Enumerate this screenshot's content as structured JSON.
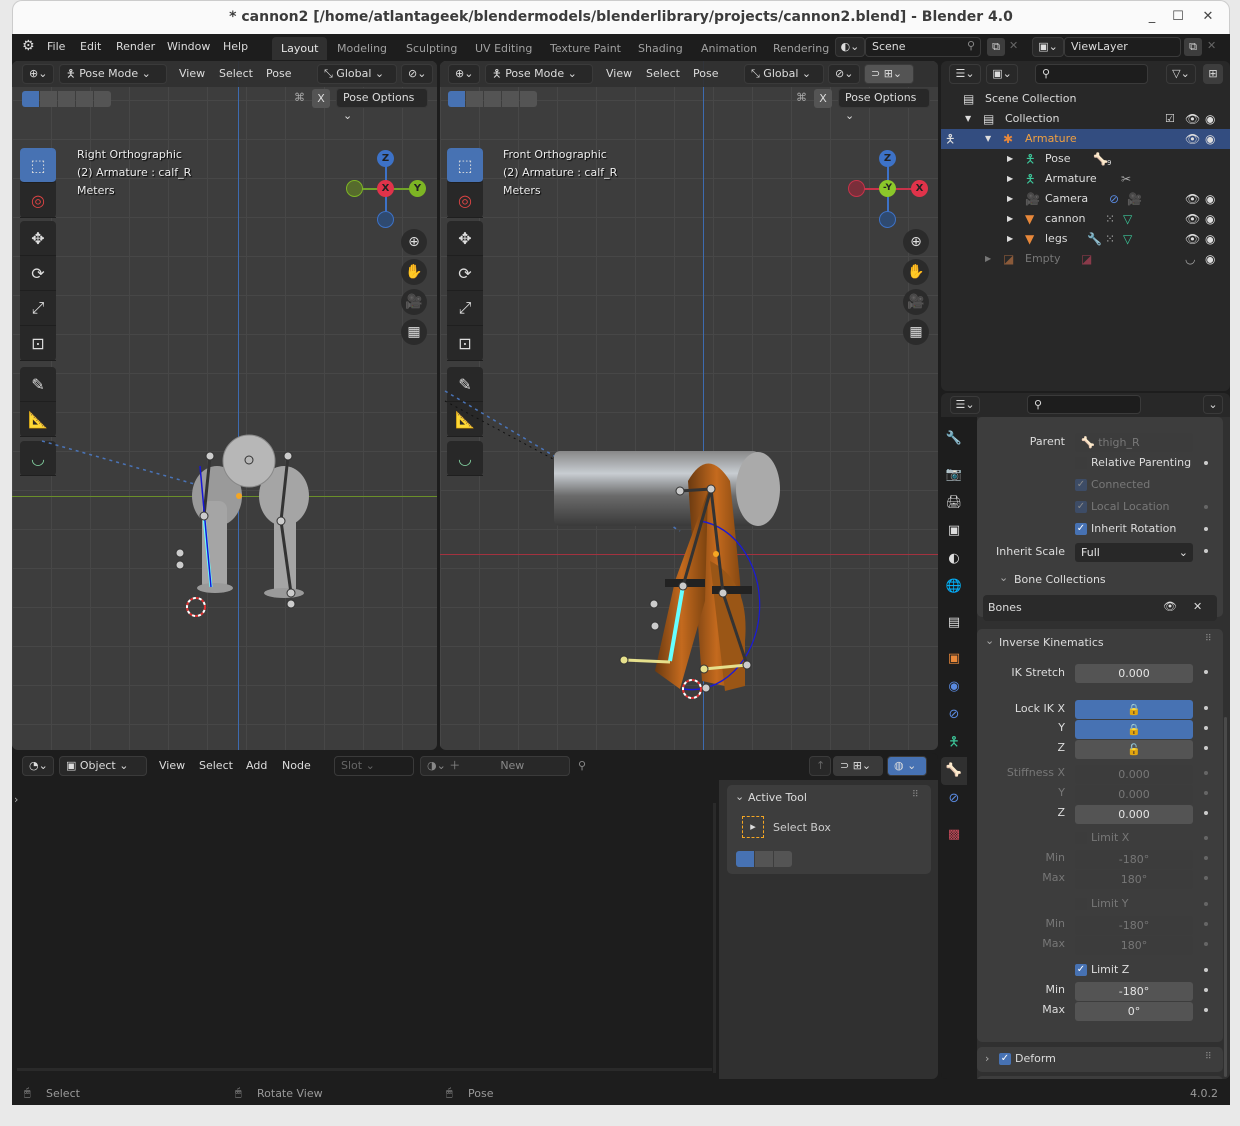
{
  "window": {
    "title": "* cannon2 [/home/atlantageek/blendermodels/blenderlibrary/projects/cannon2.blend] - Blender 4.0",
    "minimize": "_",
    "maximize": "☐",
    "close": "✕"
  },
  "topbar": {
    "menus": [
      "File",
      "Edit",
      "Render",
      "Window",
      "Help"
    ],
    "workspaces": [
      "Layout",
      "Modeling",
      "Sculpting",
      "UV Editing",
      "Texture Paint",
      "Shading",
      "Animation",
      "Rendering"
    ],
    "active_workspace": "Layout",
    "scene": "Scene",
    "view_layer": "ViewLayer"
  },
  "viewport_left": {
    "mode": "Pose Mode",
    "menus": [
      "View",
      "Select",
      "Pose"
    ],
    "orientation": "Global",
    "mirror_x": "X",
    "pose_options": "Pose Options",
    "view_name": "Right Orthographic",
    "object_info": "(2) Armature : calf_R",
    "units": "Meters",
    "gizmo": {
      "top": "Z",
      "center": "X",
      "right": "Y"
    }
  },
  "viewport_right": {
    "mode": "Pose Mode",
    "menus": [
      "View",
      "Select",
      "Pose"
    ],
    "orientation": "Global",
    "mirror_x": "X",
    "pose_options": "Pose Options",
    "view_name": "Front Orthographic",
    "object_info": "(2) Armature : calf_R",
    "units": "Meters",
    "gizmo": {
      "top": "Z",
      "center": "-Y",
      "right": "X"
    }
  },
  "shader_editor": {
    "mode": "Object",
    "menus": [
      "View",
      "Select",
      "Add",
      "Node"
    ],
    "slot": "Slot",
    "new_label": "New",
    "active_tool": {
      "header": "Active Tool",
      "name": "Select Box"
    }
  },
  "outliner": {
    "items": [
      {
        "label": "Scene Collection",
        "depth": 0
      },
      {
        "label": "Collection",
        "depth": 1
      },
      {
        "label": "Armature",
        "depth": 2,
        "selected": true
      },
      {
        "label": "Pose",
        "depth": 3
      },
      {
        "label": "Armature",
        "depth": 3
      },
      {
        "label": "Camera",
        "depth": 3
      },
      {
        "label": "cannon",
        "depth": 3
      },
      {
        "label": "legs",
        "depth": 3
      },
      {
        "label": "Empty",
        "depth": 2,
        "dimmed": true
      }
    ],
    "pose_count": "9"
  },
  "properties": {
    "parent_label": "Parent",
    "parent_value": "thigh_R",
    "relative_parenting": {
      "label": "Relative Parenting",
      "checked": false
    },
    "connected": {
      "label": "Connected",
      "checked": true
    },
    "local_location": {
      "label": "Local Location",
      "checked": true
    },
    "inherit_rotation": {
      "label": "Inherit Rotation",
      "checked": true
    },
    "inherit_scale_label": "Inherit Scale",
    "inherit_scale_value": "Full",
    "bone_collections_header": "Bone Collections",
    "bone_collection_item": "Bones",
    "ik": {
      "header": "Inverse Kinematics",
      "ik_stretch_label": "IK Stretch",
      "ik_stretch": "0.000",
      "lock_ik_x_label": "Lock IK X",
      "lock_y_label": "Y",
      "lock_z_label": "Z",
      "lock": {
        "x": true,
        "y": true,
        "z": false
      },
      "stiffness_x_label": "Stiffness X",
      "stiffness_y_label": "Y",
      "stiffness_z_label": "Z",
      "stiffness": {
        "x": "0.000",
        "y": "0.000",
        "z": "0.000"
      },
      "limit_x": {
        "label": "Limit X",
        "checked": false,
        "min": "-180°",
        "max": "180°"
      },
      "limit_y": {
        "label": "Limit Y",
        "checked": false,
        "min": "-180°",
        "max": "180°"
      },
      "limit_z": {
        "label": "Limit Z",
        "checked": true,
        "min": "-180°",
        "max": "0°"
      },
      "min_label": "Min",
      "max_label": "Max"
    },
    "deform": {
      "label": "Deform",
      "checked": true
    }
  },
  "statusbar": {
    "left": "Select",
    "middle": "Rotate View",
    "right": "Pose",
    "version": "4.0.2"
  }
}
